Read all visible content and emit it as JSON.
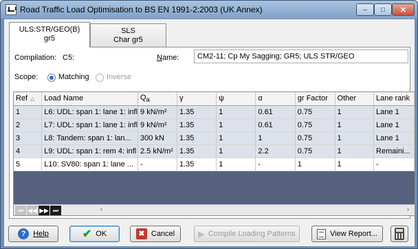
{
  "window": {
    "title": "Road Traffic Load Optimisation to BS EN 1991-2:2003 (UK Annex)",
    "controls": {
      "minimize": "–",
      "maximize": "□",
      "close": "✕"
    }
  },
  "tabs": [
    {
      "line1": "ULS:STR/GEO(B)",
      "line2": "gr5",
      "active": true
    },
    {
      "line1": "SLS",
      "line2": "Char gr5",
      "active": false
    }
  ],
  "form": {
    "compilation_label": "Compilation:",
    "compilation_value": "C5:",
    "name_label": "Name:",
    "name_value": "CM2-11; Cp My Sagging; GR5; ULS STR/GEO",
    "scope_label": "Scope:",
    "scope_options": [
      {
        "label": "Matching",
        "checked": true,
        "enabled": true
      },
      {
        "label": "Inverse",
        "checked": false,
        "enabled": false
      }
    ]
  },
  "table": {
    "columns": [
      "Ref",
      "Load Name",
      "Q",
      "γ",
      "ψ",
      "α",
      "gr Factor",
      "Other",
      "Lane rank"
    ],
    "q_subscript": "ik",
    "sort_indicator": "△",
    "rows": [
      {
        "ref": "1",
        "name": "L6: UDL: span 1: lane 1: infl",
        "q": "9 kN/m²",
        "gamma": "1.35",
        "psi": "1",
        "alpha": "0.61",
        "gr": "0.75",
        "other": "1",
        "lane": "Lane 1"
      },
      {
        "ref": "2",
        "name": "L7: UDL: span 1: lane 1: infl",
        "q": "9 kN/m²",
        "gamma": "1.35",
        "psi": "1",
        "alpha": "0.61",
        "gr": "0.75",
        "other": "1",
        "lane": "Lane 1"
      },
      {
        "ref": "3",
        "name": "L8: Tandem: span 1: lan...",
        "q": "300 kN",
        "gamma": "1.35",
        "psi": "1",
        "alpha": "1",
        "gr": "0.75",
        "other": "1",
        "lane": "Lane 1"
      },
      {
        "ref": "4",
        "name": "L9: UDL: span 1: rem 4: infl",
        "q": "2.5 kN/m²",
        "gamma": "1.35",
        "psi": "1",
        "alpha": "2.2",
        "gr": "0.75",
        "other": "1",
        "lane": "Remaini..."
      },
      {
        "ref": "5",
        "name": "L10: SV80: span 1: lane ...",
        "q": "-",
        "gamma": "1.35",
        "psi": "1",
        "alpha": "-",
        "gr": "1",
        "other": "1",
        "lane": "-"
      }
    ]
  },
  "scrollbar": {
    "nav": [
      "⏮",
      "◀◀",
      "▶▶",
      "⏭"
    ],
    "left_arrow": "‹",
    "right_arrow": "›"
  },
  "buttons": {
    "help": "Help",
    "ok": "OK",
    "cancel": "Cancel",
    "compile": "Compile Loading Patterns",
    "view_report": "View Report..."
  },
  "icons": {
    "help": "?",
    "ok": "✔",
    "cancel": "✖",
    "compile": "▶"
  }
}
